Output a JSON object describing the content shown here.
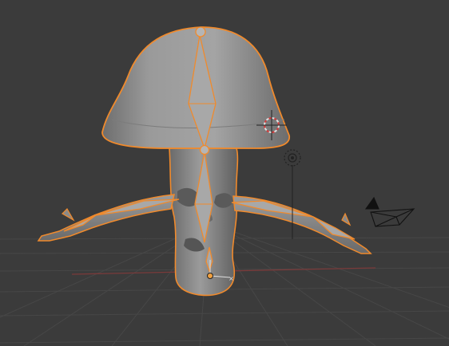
{
  "viewport": {
    "mode": "3D Viewport",
    "background_color": "#3b3b3b",
    "grid_color": "#4a4a4a",
    "x_axis_color": "#8a3b3b",
    "selection_outline_color": "#f08a2c",
    "model_color": "#8f8f8f"
  },
  "scene": {
    "object": "mushroom-character",
    "armature": "bone-armature",
    "icons": [
      "3d-cursor-icon",
      "light-icon",
      "camera-icon",
      "origin-icon",
      "transform-axis-icon"
    ]
  }
}
